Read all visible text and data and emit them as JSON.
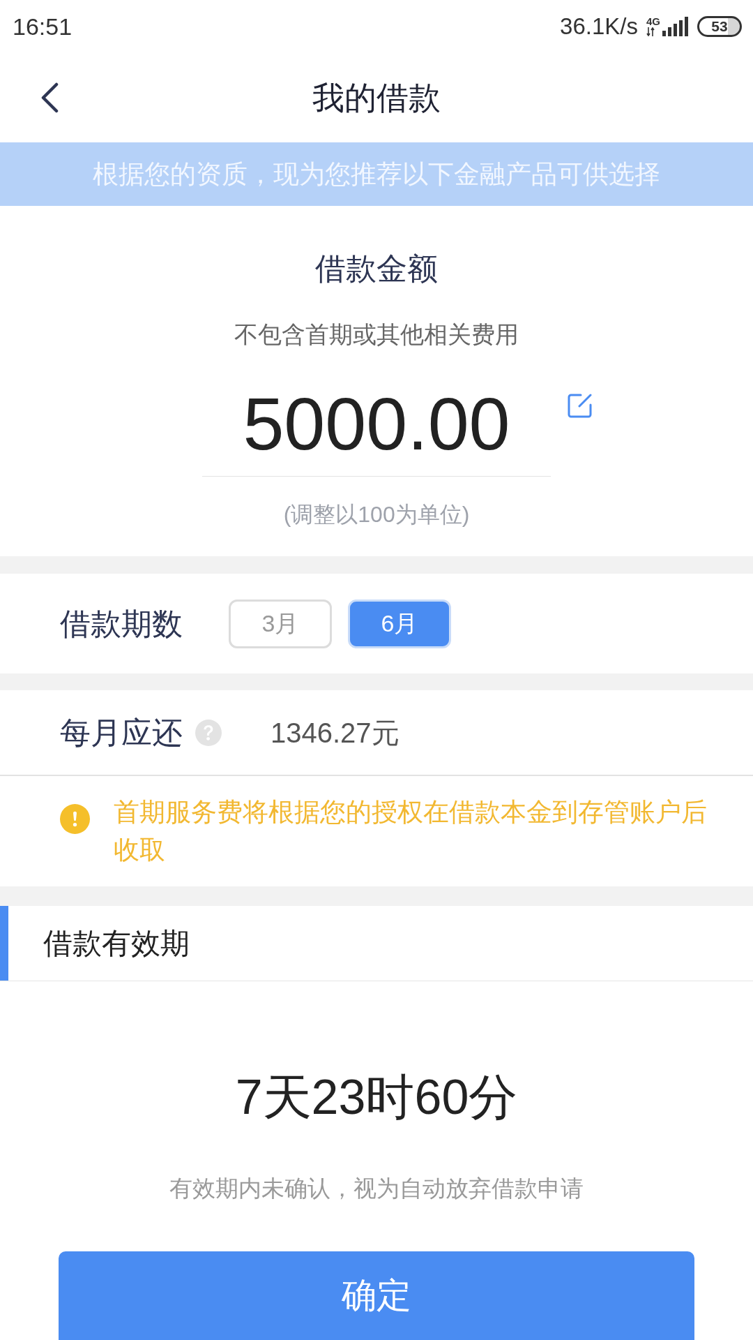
{
  "status_bar": {
    "time": "16:51",
    "network_speed": "36.1K/s",
    "network_type": "4G",
    "battery": "53"
  },
  "header": {
    "title": "我的借款"
  },
  "banner": {
    "text": "根据您的资质，现为您推荐以下金融产品可供选择"
  },
  "amount_card": {
    "title": "借款金额",
    "subtitle": "不包含首期或其他相关费用",
    "amount": "5000.00",
    "hint": "(调整以100为单位)"
  },
  "term": {
    "label": "借款期数",
    "options": [
      {
        "label": "3月",
        "selected": false
      },
      {
        "label": "6月",
        "selected": true
      }
    ]
  },
  "monthly": {
    "label": "每月应还",
    "value": "1346.27元"
  },
  "notice": {
    "text": "首期服务费将根据您的授权在借款本金到存管账户后收取"
  },
  "validity": {
    "title": "借款有效期",
    "countdown": "7天23时60分",
    "note": "有效期内未确认，视为自动放弃借款申请"
  },
  "confirm_button": {
    "label": "确定"
  }
}
